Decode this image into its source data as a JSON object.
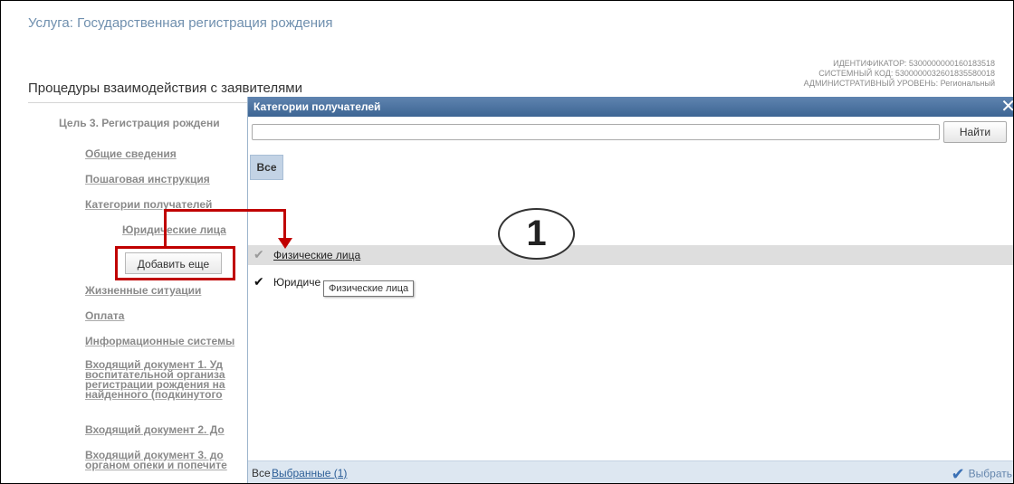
{
  "service_title": "Услуга: Государственная регистрация рождения",
  "identifiers": {
    "id_line": "ИДЕНТИФИКАТОР: 5300000000160183518",
    "system_code_line": "СИСТЕМНЫЙ КОД: 5300000032601835580018",
    "admin_level_line": "АДМИНИСТРАТИВНЫЙ УРОВЕНЬ: Региональный"
  },
  "procedures_title": "Процедуры взаимодействия с заявителями",
  "nav": {
    "goal": "Цель 3. Регистрация рождени",
    "general_info": "Общие сведения",
    "step_guide": "Пошаговая инструкция",
    "recipient_categories": "Категории получателей",
    "legal_entities": "Юридические лица",
    "add_more": "Добавить еще",
    "life_situations": "Жизненные ситуации",
    "payment": "Оплата",
    "info_systems": "Информационные системы",
    "incoming_doc1": [
      "Входящий документ 1. Уд",
      "воспитательной организа",
      "регистрации рождения на",
      "найденного (подкинутого"
    ],
    "incoming_doc2": "Входящий документ 2. До",
    "incoming_doc3": [
      "Входящий документ 3. до",
      "органом опеки и попечите"
    ]
  },
  "modal": {
    "title": "Категории получателей",
    "search_placeholder": "",
    "find_label": "Найти",
    "tab_all": "Все",
    "items": [
      {
        "label": "Физические лица",
        "checked": true
      },
      {
        "label": "Юридиче",
        "checked": true
      }
    ],
    "tooltip": "Физические лица",
    "footer_all": "Все",
    "footer_selected": "Выбранные (1)",
    "choose_label": "Выбрать"
  },
  "annotation": {
    "step_number": "1"
  },
  "colors": {
    "header_blue": "#4a72a0",
    "annotation_red": "#c00000",
    "footer_bg": "#dde7f1"
  }
}
